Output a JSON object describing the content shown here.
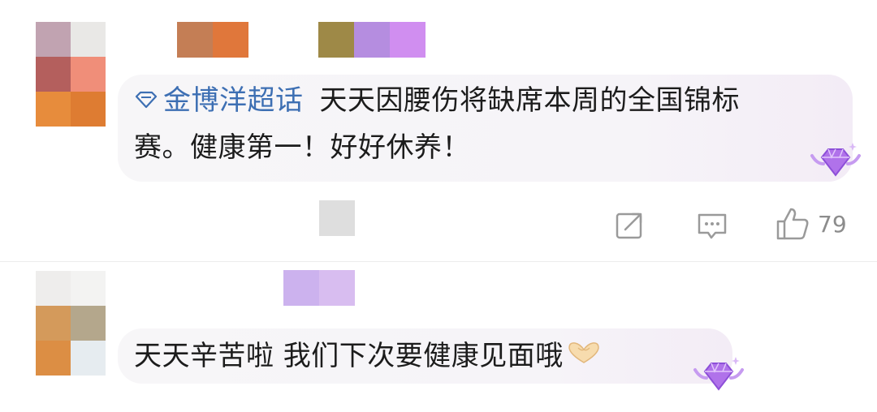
{
  "comments": [
    {
      "topic_label": "金博洋超话",
      "text_line1": "天天因腰伤将缺席本周的全国锦标",
      "text_line2": "赛。健康第一！好好休养！",
      "likes": "79",
      "share_icon": "share-icon",
      "comment_icon": "comment-icon",
      "like_icon": "thumbs-up-icon"
    },
    {
      "text": "天天辛苦啦 我们下次要健康见面哦",
      "emoji": "heart-hands-emoji"
    }
  ],
  "colors": {
    "topic_link": "#3d6fb3",
    "bubble_bg": "#f6f4f8",
    "icon_gray": "#9a9a9a"
  }
}
